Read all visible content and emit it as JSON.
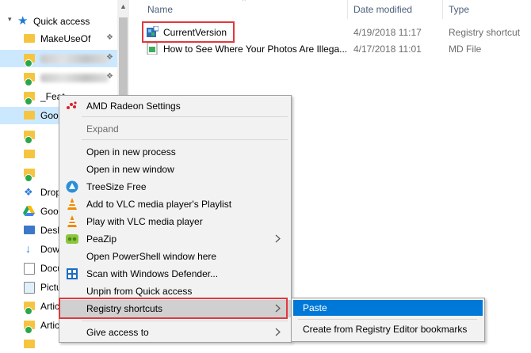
{
  "nav": {
    "quick_access_label": "Quick access",
    "items": [
      {
        "label": "MakeUseOf"
      },
      {
        "label": ""
      },
      {
        "label": ""
      },
      {
        "label": "_Feat"
      },
      {
        "label": "Goog"
      },
      {
        "label": ""
      },
      {
        "label": ""
      },
      {
        "label": ""
      },
      {
        "label": "Drop"
      },
      {
        "label": "Goog"
      },
      {
        "label": "Desk"
      },
      {
        "label": "Dow"
      },
      {
        "label": "Docu"
      },
      {
        "label": "Pictu"
      },
      {
        "label": "Artic"
      },
      {
        "label": "Artic"
      }
    ]
  },
  "columns": {
    "name": "Name",
    "date_modified": "Date modified",
    "type": "Type"
  },
  "files": [
    {
      "name": "CurrentVersion",
      "date": "4/19/2018 11:17",
      "type": "Registry shortcut"
    },
    {
      "name": "How to See Where Your Photos Are Illega...",
      "date": "4/17/2018 11:01",
      "type": "MD File"
    }
  ],
  "context_menu": {
    "items": [
      {
        "label": "AMD Radeon Settings",
        "icon": "amd-radeon-icon"
      },
      {
        "label": "Expand",
        "disabled": true
      },
      {
        "label": "Open in new process"
      },
      {
        "label": "Open in new window"
      },
      {
        "label": "TreeSize Free",
        "icon": "treesize-icon"
      },
      {
        "label": "Add to VLC media player's Playlist",
        "icon": "vlc-icon"
      },
      {
        "label": "Play with VLC media player",
        "icon": "vlc-icon"
      },
      {
        "label": "PeaZip",
        "icon": "peazip-icon",
        "submenu": true
      },
      {
        "label": "Open PowerShell window here"
      },
      {
        "label": "Scan with Windows Defender...",
        "icon": "windows-defender-icon"
      },
      {
        "label": "Unpin from Quick access"
      },
      {
        "label": "Registry shortcuts",
        "submenu": true,
        "active": true
      },
      {
        "label": "Give access to",
        "submenu": true
      }
    ]
  },
  "submenu": {
    "items": [
      {
        "label": "Paste",
        "active": true
      },
      {
        "label": "Create from Registry Editor bookmarks"
      }
    ]
  },
  "colors": {
    "highlight_red": "#e0393e",
    "selection_blue": "#cce8ff",
    "submenu_active": "#0078d7"
  }
}
